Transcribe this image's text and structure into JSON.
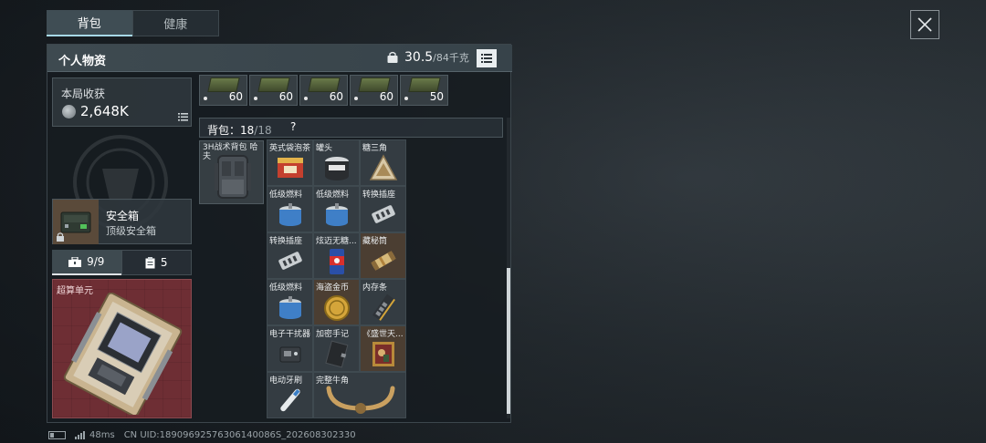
{
  "tabs": [
    {
      "label": "背包",
      "active": true
    },
    {
      "label": "健康",
      "active": false
    }
  ],
  "panel": {
    "title": "个人物资",
    "weight_current": "30.5",
    "weight_max": "/84千克"
  },
  "round_loot": {
    "label": "本局收获",
    "value": "2,648K"
  },
  "safe_box": {
    "name": "安全箱",
    "subtitle": "顶级安全箱"
  },
  "mini_tabs": [
    {
      "label": "9/9",
      "icon": "toolbox-icon",
      "active": true
    },
    {
      "label": "5",
      "icon": "clipboard-icon",
      "active": false
    }
  ],
  "special_slot": {
    "label": "超算单元"
  },
  "ammo": [
    {
      "count": "60"
    },
    {
      "count": "60"
    },
    {
      "count": "60"
    },
    {
      "count": "60"
    },
    {
      "count": "50"
    }
  ],
  "backpack": {
    "label": "背包：",
    "current": "18",
    "max": "/18",
    "help": "?",
    "item_name": "3H战术背包 哈夫"
  },
  "grid_items": [
    {
      "name": "英式袋泡茶",
      "icon": "tea-box-icon"
    },
    {
      "name": "罐头",
      "icon": "can-icon"
    },
    {
      "name": "糖三角",
      "icon": "triangle-cake-icon"
    },
    {
      "name": "低级燃料",
      "icon": "fuel-can-icon"
    },
    {
      "name": "低级燃料",
      "icon": "fuel-can-icon"
    },
    {
      "name": "转换插座",
      "icon": "power-adapter-icon"
    },
    {
      "name": "转换插座",
      "icon": "power-adapter-icon"
    },
    {
      "name": "炫迈无糖...",
      "icon": "gum-pack-icon"
    },
    {
      "name": "藏秘筒",
      "icon": "scroll-tube-icon"
    },
    {
      "name": "低级燃料",
      "icon": "fuel-can-icon"
    },
    {
      "name": "海盗金币",
      "icon": "gold-coin-icon"
    },
    {
      "name": "内存条",
      "icon": "memory-stick-icon"
    },
    {
      "name": "电子干扰器",
      "icon": "jammer-icon"
    },
    {
      "name": "加密手记",
      "icon": "notebook-icon"
    },
    {
      "name": "《盛世天...",
      "icon": "painting-icon"
    },
    {
      "name": "电动牙刷",
      "icon": "toothbrush-icon"
    },
    {
      "name": "完整牛角",
      "icon": "horns-icon"
    }
  ],
  "status": {
    "ping": "48ms",
    "uid": "CN UID:18909692576306140086S_202608302330"
  },
  "colors": {
    "accent": "#a7d8e6",
    "special_bg": "#6e2e34",
    "brown_cell": "#4e4034"
  }
}
